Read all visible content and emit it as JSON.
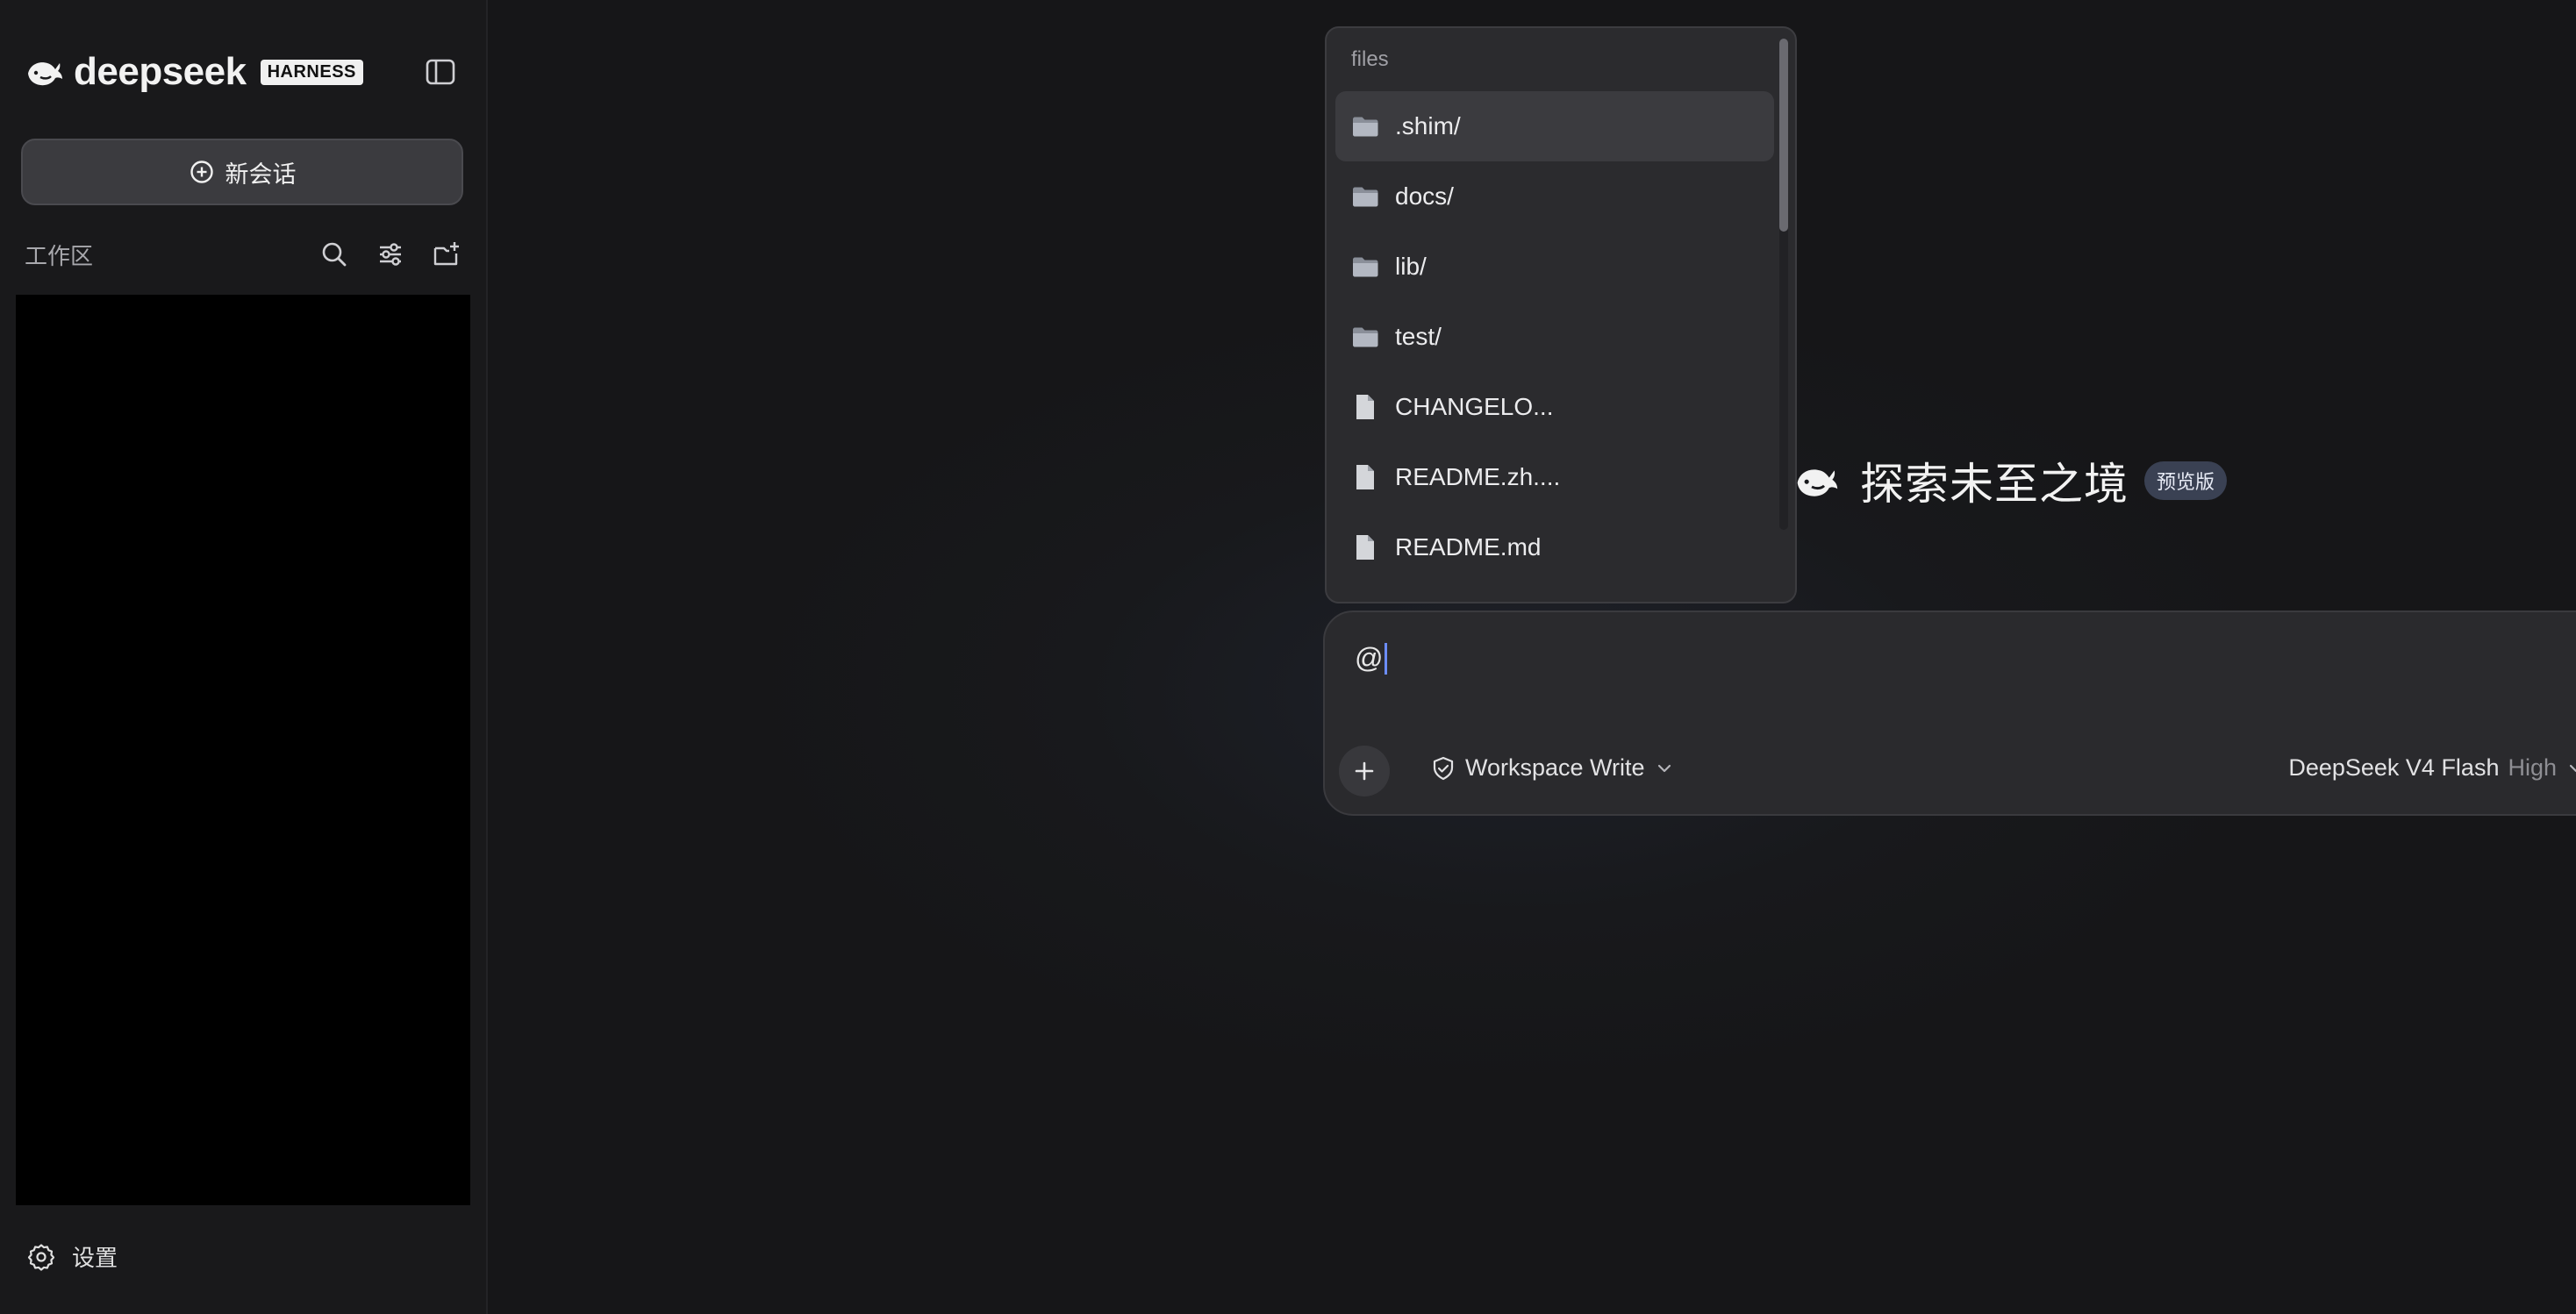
{
  "sidebar": {
    "brand_name": "deepseek",
    "brand_badge": "HARNESS",
    "new_chat_label": "新会话",
    "workspace_title": "工作区",
    "settings_label": "设置"
  },
  "main": {
    "hero_title": "探索未至之境",
    "hero_badge": "预览版"
  },
  "composer": {
    "input_value": "@",
    "mode_label": "Workspace Write",
    "model_name": "DeepSeek V4 Flash",
    "model_effort": "High"
  },
  "file_picker": {
    "title": "files",
    "items": [
      {
        "name": ".shim/",
        "type": "folder"
      },
      {
        "name": "docs/",
        "type": "folder"
      },
      {
        "name": "lib/",
        "type": "folder"
      },
      {
        "name": "test/",
        "type": "folder"
      },
      {
        "name": "CHANGELO...",
        "type": "file"
      },
      {
        "name": "README.zh....",
        "type": "file"
      },
      {
        "name": "README.md",
        "type": "file"
      }
    ]
  },
  "colors": {
    "accent": "#6b8ff5",
    "sidebar_bg": "#19191b",
    "main_bg": "#161618",
    "composer_bg": "#2a2a2d",
    "badge_bg": "#3a4153"
  },
  "icons": {
    "brand": "whale-logo-icon",
    "collapse": "sidebar-toggle-icon",
    "new_chat": "plus-circle-icon",
    "search": "search-icon",
    "filter": "sliders-icon",
    "new_folder": "folder-plus-icon",
    "settings": "gear-icon",
    "attach": "plus-icon",
    "mode": "shield-check-icon",
    "chevron": "chevron-down-icon",
    "send": "arrow-up-icon",
    "folder": "folder-icon",
    "file": "file-icon"
  }
}
